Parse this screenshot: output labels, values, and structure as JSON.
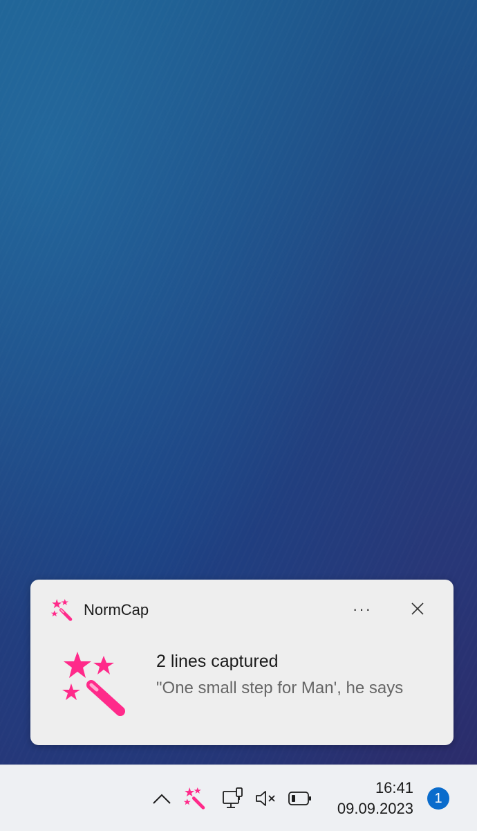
{
  "notification": {
    "app_name": "NormCap",
    "more_label": "···",
    "title": "2 lines captured",
    "body": "\"One small step for Man', he says"
  },
  "taskbar": {
    "time": "16:41",
    "date": "09.09.2023",
    "notification_count": "1"
  },
  "colors": {
    "accent_pink": "#ff2a8a",
    "badge_blue": "#0a6ccc"
  },
  "icons": {
    "app": "magic-wand-icon",
    "more": "more-options-icon",
    "close": "close-icon",
    "tray_overflow": "chevron-up-icon",
    "network": "network-icon",
    "volume": "volume-muted-icon",
    "battery": "battery-icon"
  }
}
